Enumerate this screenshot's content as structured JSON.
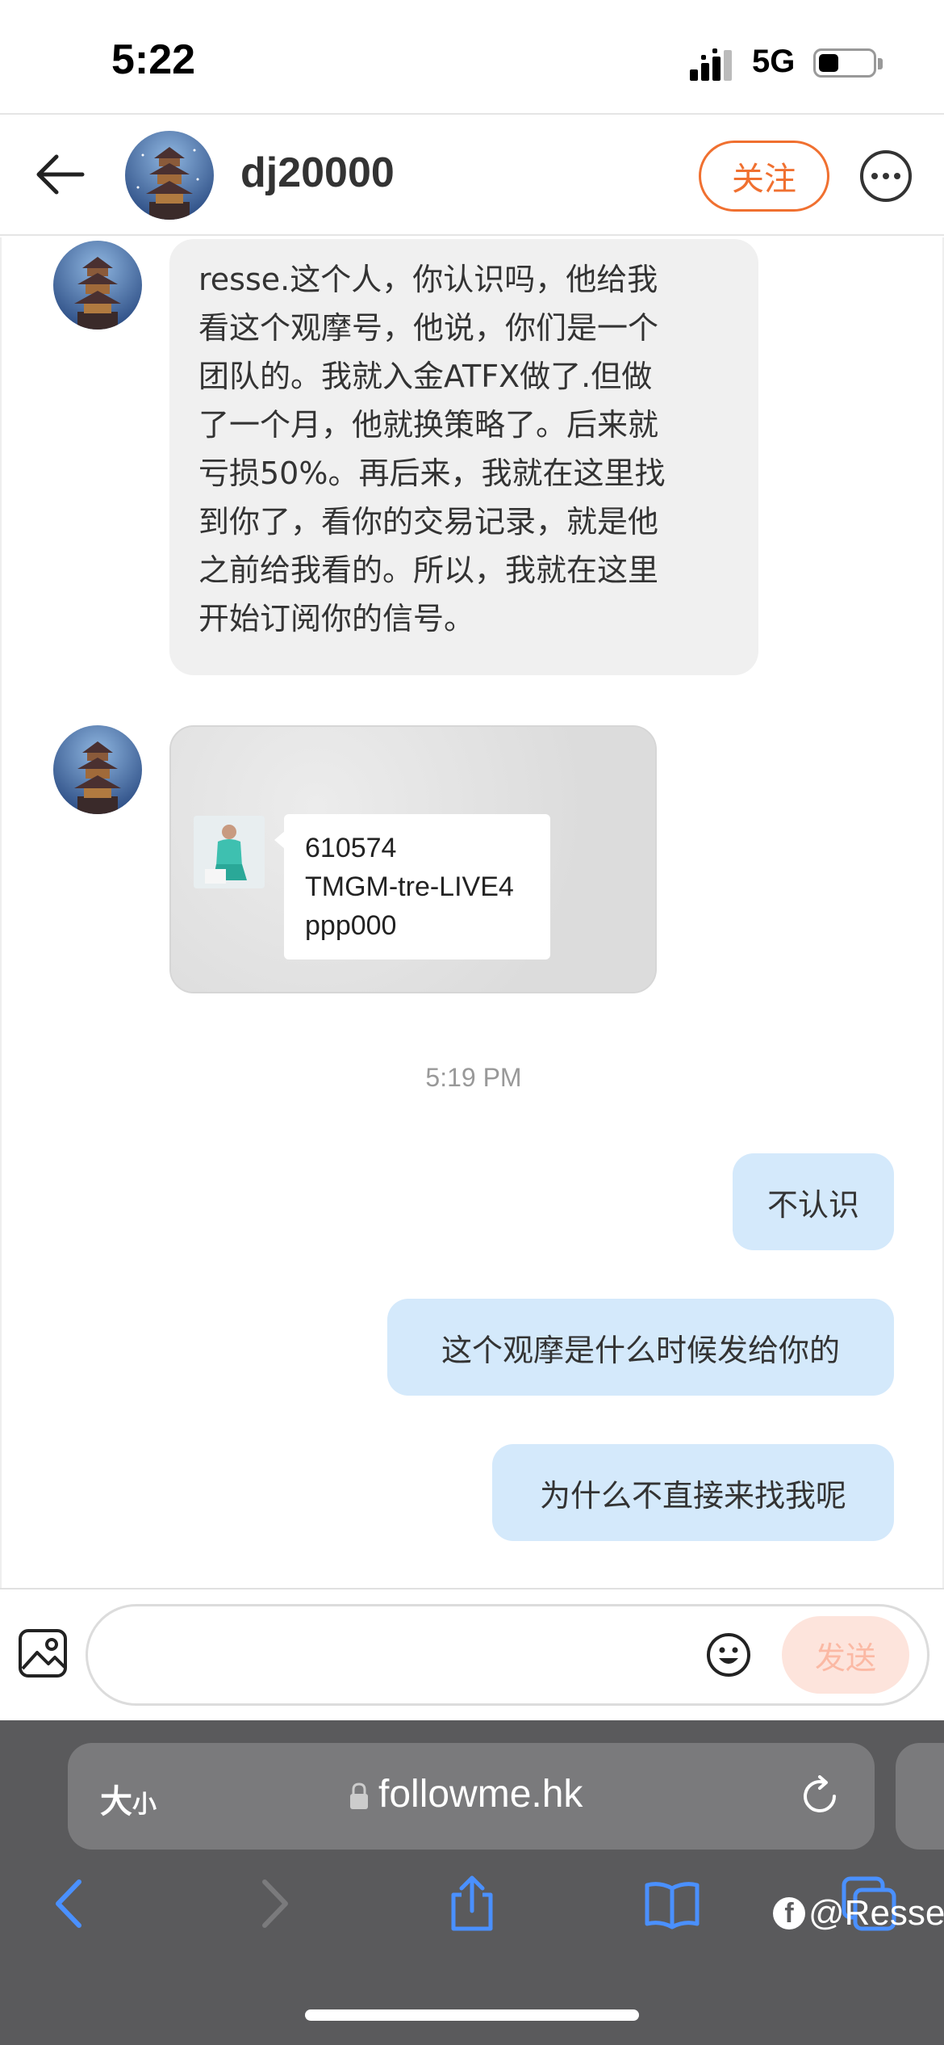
{
  "status_bar": {
    "time": "5:22",
    "network": "5G"
  },
  "header": {
    "username": "dj20000",
    "follow_label": "关注"
  },
  "messages": {
    "incoming_text": "resse.这个人，你认识吗，他给我看这个观摩号，他说，你们是一个团队的。我就入金ATFX做了.但做了一个月，他就换策略了。后来就亏损50%。再后来，我就在这里找到你了，看你的交易记录，就是他之前给我看的。所以，我就在这里开始订阅你的信号。",
    "incoming_text_lines": [
      "resse.这个人，你认识吗，他给我",
      "看这个观摩号，他说，你们是一个",
      "团队的。我就入金ATFX做了.但做",
      "了一个月，他就换策略了。后来就",
      "亏损50%。再后来，我就在这里找",
      "到你了，看你的交易记录，就是他",
      "之前给我看的。所以，我就在这里",
      "开始订阅你的信号。"
    ],
    "image_card": {
      "line1": "610574",
      "line2": "TMGM-tre-LIVE4",
      "line3": "ppp000"
    },
    "timestamp": "5:19 PM",
    "outgoing": [
      "不认识",
      "这个观摩是什么时候发给你的",
      "为什么不直接来找我呢"
    ]
  },
  "input": {
    "placeholder": "",
    "send_label": "发送"
  },
  "browser": {
    "text_size_large": "大",
    "text_size_small": "小",
    "url": "followme.hk"
  },
  "watermark": {
    "text": "@Resse"
  },
  "colors": {
    "accent": "#f07030",
    "outgoing_bubble": "#d4e9fb",
    "incoming_bubble": "#f0f0f0",
    "safari_blue": "#4a90ff"
  },
  "icons": [
    "back-arrow-icon",
    "more-icon",
    "image-icon",
    "emoji-icon",
    "lock-icon",
    "reload-icon",
    "back-nav-icon",
    "forward-nav-icon",
    "share-icon",
    "bookmarks-icon",
    "tabs-icon",
    "facebook-icon"
  ]
}
